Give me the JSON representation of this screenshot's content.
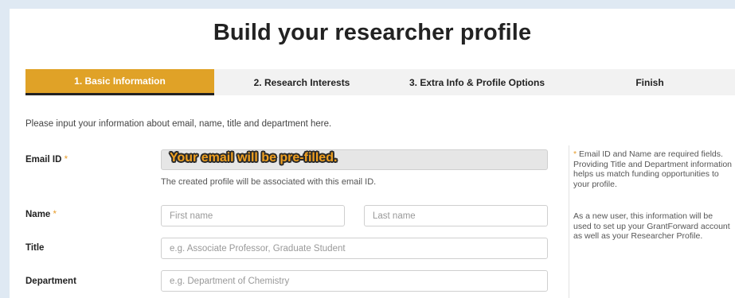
{
  "title": "Build your researcher profile",
  "tabs": [
    {
      "label": "1. Basic Information",
      "active": true
    },
    {
      "label": "2. Research Interests",
      "active": false
    },
    {
      "label": "3. Extra Info & Profile Options",
      "active": false
    },
    {
      "label": "Finish",
      "active": false
    }
  ],
  "intro": "Please input your information about email, name, title and department here.",
  "form": {
    "required_marker": "*",
    "email": {
      "label": "Email ID",
      "overlay": "Your email will be pre-filled.",
      "helper": "The created profile will be associated with this email ID."
    },
    "name": {
      "label": "Name",
      "first_placeholder": "First name",
      "last_placeholder": "Last name"
    },
    "title": {
      "label": "Title",
      "placeholder": "e.g. Associate Professor, Graduate Student"
    },
    "department": {
      "label": "Department",
      "placeholder": "e.g. Department of Chemistry"
    }
  },
  "sidebar": {
    "note1": "Email ID and Name are required fields. Providing Title and Department information helps us match funding opportunities to your profile.",
    "note2": "As a new user, this information will be used to set up your GrantForward account as well as your Researcher Profile."
  },
  "colors": {
    "accent": "#e0a227",
    "required": "#e79c2a",
    "background": "#dfe9f3"
  }
}
